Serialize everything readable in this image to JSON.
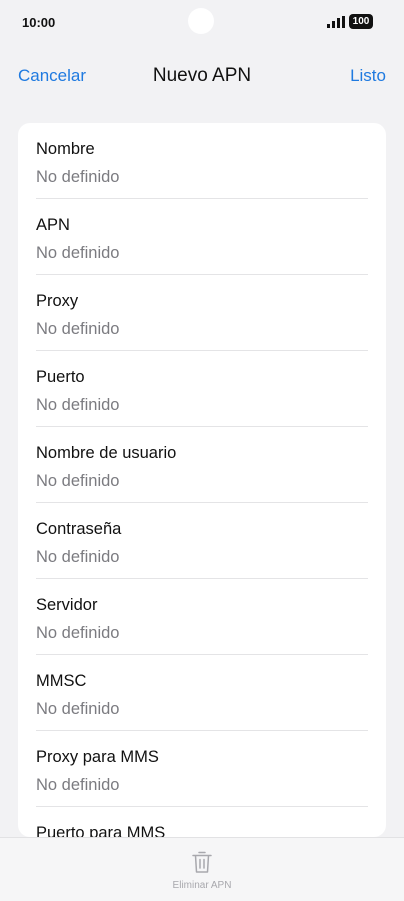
{
  "status_bar": {
    "time": "10:00",
    "battery": "100",
    "signal_icon": "cellular-signal-icon"
  },
  "nav": {
    "cancel_label": "Cancelar",
    "title": "Nuevo APN",
    "done_label": "Listo"
  },
  "fields": [
    {
      "label": "Nombre",
      "value": "No definido"
    },
    {
      "label": "APN",
      "value": "No definido"
    },
    {
      "label": "Proxy",
      "value": "No definido"
    },
    {
      "label": "Puerto",
      "value": "No definido"
    },
    {
      "label": "Nombre de usuario",
      "value": "No definido"
    },
    {
      "label": "Contraseña",
      "value": "No definido"
    },
    {
      "label": "Servidor",
      "value": "No definido"
    },
    {
      "label": "MMSC",
      "value": "No definido"
    },
    {
      "label": "Proxy para MMS",
      "value": "No definido"
    },
    {
      "label": "Puerto para MMS",
      "value": ""
    }
  ],
  "bottom_bar": {
    "delete_label": "Eliminar APN",
    "delete_icon": "trash-icon"
  },
  "colors": {
    "accent": "#1f7ae0",
    "background": "#f2f2f4",
    "secondary_text": "#7b7b80",
    "disabled_text": "#a8a8ad"
  }
}
